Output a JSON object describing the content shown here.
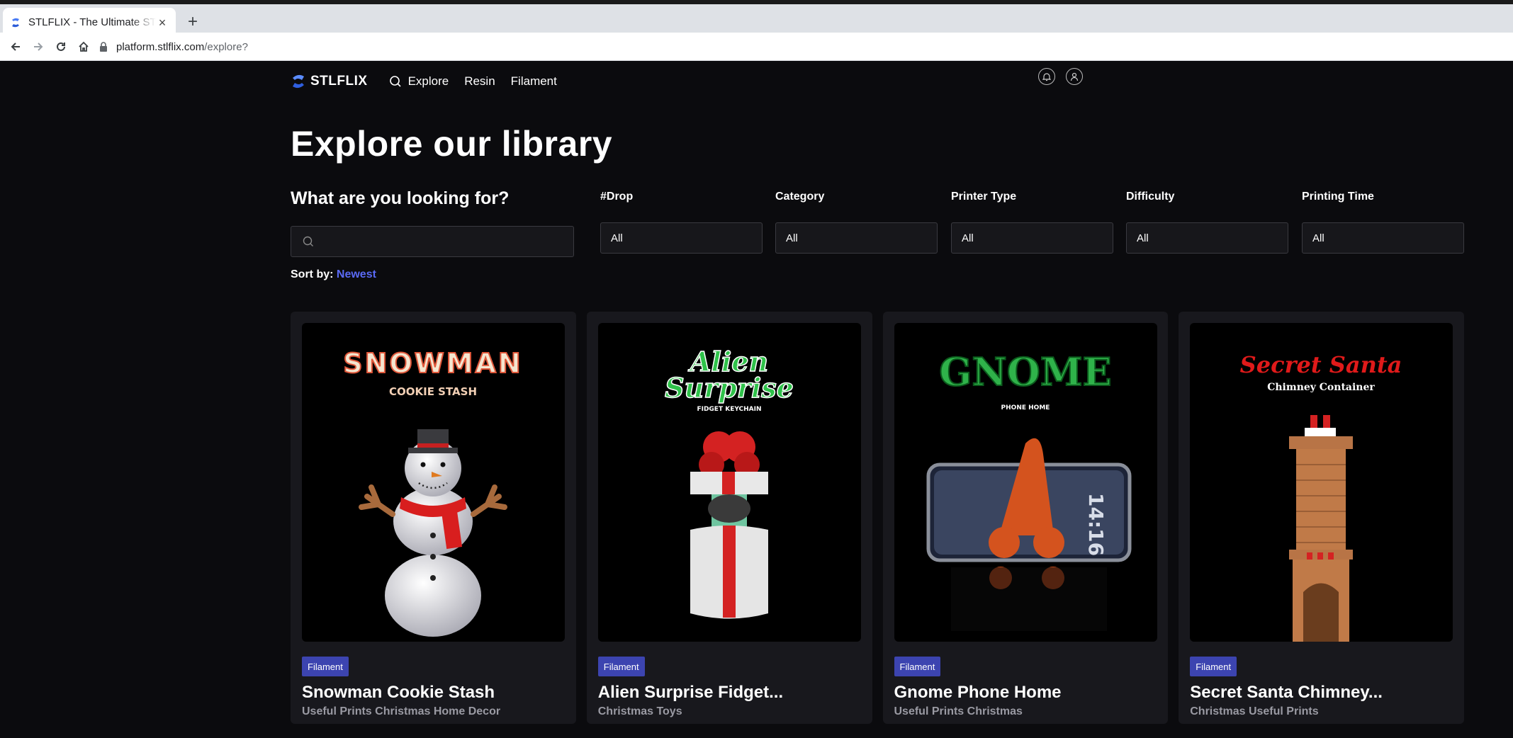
{
  "browser": {
    "tab_title": "STLFLIX - The Ultimate STL",
    "new_tab": "+",
    "url_host": "platform.stlflix.com",
    "url_path": "/explore?"
  },
  "nav": {
    "logo": "STLFLIX",
    "links": [
      "Explore",
      "Resin",
      "Filament"
    ]
  },
  "page": {
    "title": "Explore our library",
    "question": "What are you looking for?",
    "search_placeholder": ""
  },
  "filters": [
    {
      "label": "#Drop",
      "value": "All"
    },
    {
      "label": "Category",
      "value": "All"
    },
    {
      "label": "Printer Type",
      "value": "All"
    },
    {
      "label": "Difficulty",
      "value": "All"
    },
    {
      "label": "Printing Time",
      "value": "All"
    }
  ],
  "sort": {
    "label": "Sort by:",
    "value": "Newest"
  },
  "cards": [
    {
      "badge": "Filament",
      "name": "Snowman Cookie Stash",
      "tags": "Useful Prints Christmas Home Decor",
      "art_title": "SNOWMAN",
      "art_sub": "COOKIE STASH"
    },
    {
      "badge": "Filament",
      "name": "Alien Surprise Fidget...",
      "tags": "Christmas Toys",
      "art_title": "Alien",
      "art_title2": "Surprise",
      "art_sub": "FIDGET KEYCHAIN"
    },
    {
      "badge": "Filament",
      "name": "Gnome Phone Home",
      "tags": "Useful Prints Christmas",
      "art_title": "GNOME",
      "art_sub": "PHONE HOME",
      "art_clock": "14:16"
    },
    {
      "badge": "Filament",
      "name": "Secret Santa Chimney...",
      "tags": "Christmas Useful Prints",
      "art_title": "Secret Santa",
      "art_sub": "Chimney Container"
    }
  ],
  "colors": {
    "background": "#0b0b0e",
    "card": "#18181d",
    "badge": "#3c44b0",
    "accent": "#5a6af5"
  }
}
